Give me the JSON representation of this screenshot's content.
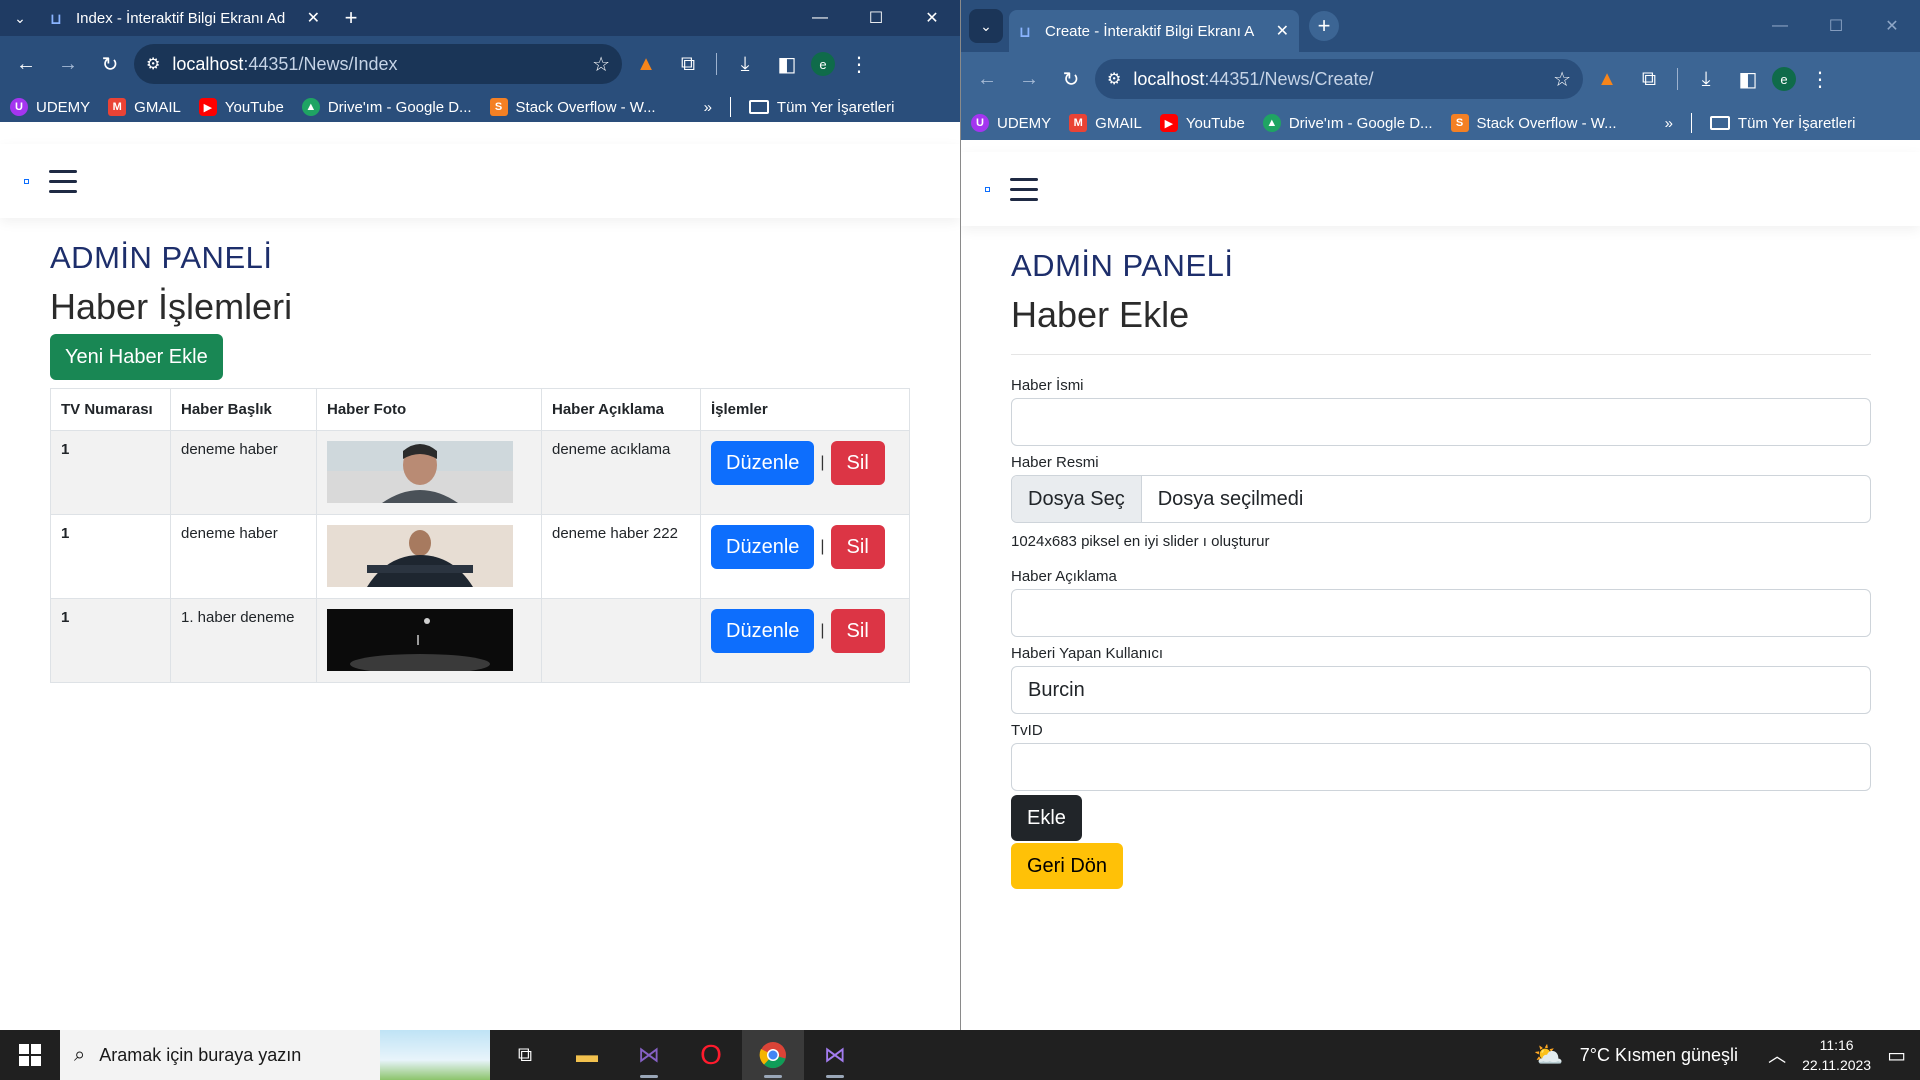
{
  "left_window": {
    "tab_title": "Index - İnteraktif Bilgi Ekranı Ad",
    "url_host": "localhost",
    "url_path": ":44351/News/Index",
    "page": {
      "admin_title": "ADMİN PANELİ",
      "heading": "Haber İşlemleri",
      "new_button": "Yeni Haber Ekle",
      "table": {
        "headers": [
          "TV Numarası",
          "Haber Başlık",
          "Haber Foto",
          "Haber Açıklama",
          "İşlemler"
        ],
        "rows": [
          {
            "tv": "1",
            "title": "deneme haber",
            "description": "deneme acıklama"
          },
          {
            "tv": "1",
            "title": "deneme haber",
            "description": "deneme haber 222"
          },
          {
            "tv": "1",
            "title": "1. haber deneme",
            "description": ""
          }
        ],
        "edit_label": "Düzenle",
        "delete_label": "Sil",
        "separator": "|"
      }
    }
  },
  "right_window": {
    "tab_title": "Create - İnteraktif Bilgi Ekranı A",
    "url_host": "localhost",
    "url_path": ":44351/News/Create/",
    "page": {
      "admin_title": "ADMİN PANELİ",
      "heading": "Haber Ekle",
      "fields": {
        "name_label": "Haber İsmi",
        "name_value": "",
        "image_label": "Haber Resmi",
        "file_button": "Dosya Seç",
        "file_status": "Dosya seçilmedi",
        "image_hint": "1024x683 piksel en iyi slider ı oluşturur",
        "desc_label": "Haber Açıklama",
        "desc_value": "",
        "user_label": "Haberi Yapan Kullanıcı",
        "user_value": "Burcin",
        "tvid_label": "TvID",
        "tvid_value": ""
      },
      "submit_label": "Ekle",
      "back_label": "Geri Dön"
    }
  },
  "bookmarks": {
    "items": [
      "UDEMY",
      "GMAIL",
      "YouTube",
      "Drive'ım - Google D...",
      "Stack Overflow - W..."
    ],
    "more": "»",
    "all": "Tüm Yer İşaretleri"
  },
  "avatar_letter": "e",
  "taskbar": {
    "search_placeholder": "Aramak için buraya yazın",
    "weather": "7°C  Kısmen güneşli",
    "time": "11:16",
    "date": "22.11.2023"
  },
  "colors": {
    "primary": "#0d6efd",
    "success": "#198754",
    "danger": "#dc3545",
    "dark": "#212529",
    "warning": "#ffc107",
    "admin_title": "#1d2e6b"
  }
}
